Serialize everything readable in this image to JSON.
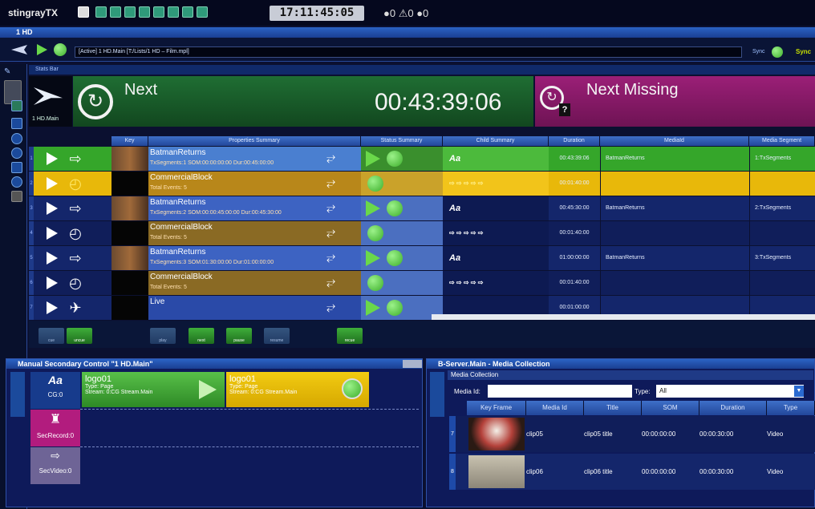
{
  "app": {
    "brand": "stingrayTX",
    "clock": "17:11:45:05",
    "counters": "●0 ⚠0 ●0"
  },
  "window": {
    "title": "1 HD",
    "status": "[Active] 1 HD.Main [T:/Lists/1 HD – Film.mpl]",
    "sync_label": "Sync",
    "sync_tail": "Sync"
  },
  "stats": {
    "title": "Stats Bar",
    "channel": "1 HD.Main",
    "next_label": "Next",
    "next_time": "00:43:39:06",
    "missing_label": "Next Missing",
    "next_color": "#1f6e33",
    "missing_color": "#9b1f77"
  },
  "grid": {
    "headers": [
      "Key",
      "Properties Summary",
      "Status Summary",
      "Child Summary",
      "Duration",
      "MediaId",
      "Media Segment"
    ],
    "rows": [
      {
        "num": "1",
        "title": "BatmanReturns",
        "sub": "TxSegments:1 SOM:00:00:00:00 Dur:00:45:00:00",
        "child": "Aa",
        "duration": "00:43:39:06",
        "media": "BatmanReturns",
        "segment": "1:TxSegments",
        "kind": "movie",
        "state": "active"
      },
      {
        "num": "2",
        "title": "CommercialBlock",
        "sub": "Total Events: 5",
        "child": "⇨ ⇨ ⇨ ⇨ ⇨",
        "duration": "00:01:40:00",
        "media": "",
        "segment": "",
        "kind": "block",
        "state": "next"
      },
      {
        "num": "3",
        "title": "BatmanReturns",
        "sub": "TxSegments:2 SOM:00:00:45:00:00 Dur:00:45:30:00",
        "child": "Aa",
        "duration": "00:45:30:00",
        "media": "BatmanReturns",
        "segment": "2:TxSegments",
        "kind": "movie",
        "state": "normal"
      },
      {
        "num": "4",
        "title": "CommercialBlock",
        "sub": "Total Events: 5",
        "child": "⇨ ⇨ ⇨ ⇨ ⇨",
        "duration": "00:01:40:00",
        "media": "",
        "segment": "",
        "kind": "block",
        "state": "normal"
      },
      {
        "num": "5",
        "title": "BatmanReturns",
        "sub": "TxSegments:3 SOM:01:30:00:00 Dur:01:00:00:00",
        "child": "Aa",
        "duration": "01:00:00:00",
        "media": "BatmanReturns",
        "segment": "3:TxSegments",
        "kind": "movie",
        "state": "normal"
      },
      {
        "num": "6",
        "title": "CommercialBlock",
        "sub": "Total Events: 5",
        "child": "⇨ ⇨ ⇨ ⇨ ⇨",
        "duration": "00:01:40:00",
        "media": "",
        "segment": "",
        "kind": "block",
        "state": "normal"
      },
      {
        "num": "7",
        "title": "Live",
        "sub": "",
        "child": "",
        "duration": "00:01:00:00",
        "media": "",
        "segment": "",
        "kind": "live",
        "state": "normal"
      }
    ]
  },
  "transport": [
    "cue",
    "uncue",
    "play",
    "next",
    "pause",
    "resume",
    "recue"
  ],
  "msc": {
    "title": "Manual Secondary Control \"1 HD.Main\"",
    "cards": [
      {
        "title": "logo01",
        "type": "Type: Page",
        "stream": "Stream: 0:CG Stream.Main"
      },
      {
        "title": "logo01",
        "type": "Type: Page",
        "stream": "Stream: 0:CG Stream.Main"
      }
    ],
    "tracks": [
      {
        "icon": "Aa",
        "label": "CG:0"
      },
      {
        "icon": "♜",
        "label": "SecRecord:0"
      },
      {
        "icon": "⇨",
        "label": "SecVideo:0"
      }
    ]
  },
  "media": {
    "title": "B-Server.Main - Media Collection",
    "sub": "Media Collection",
    "media_id_label": "Media Id:",
    "type_label": "Type:",
    "type_value": "All",
    "headers": [
      "Key Frame",
      "Media Id",
      "Title",
      "SOM",
      "Duration",
      "Type"
    ],
    "rows": [
      {
        "num": "7",
        "id": "clip05",
        "title": "clip05 title",
        "som": "00:00:00:00",
        "duration": "00:00:30:00",
        "type": "Video"
      },
      {
        "num": "8",
        "id": "clip06",
        "title": "clip06 title",
        "som": "00:00:00:00",
        "duration": "00:00:30:00",
        "type": "Video"
      }
    ]
  }
}
